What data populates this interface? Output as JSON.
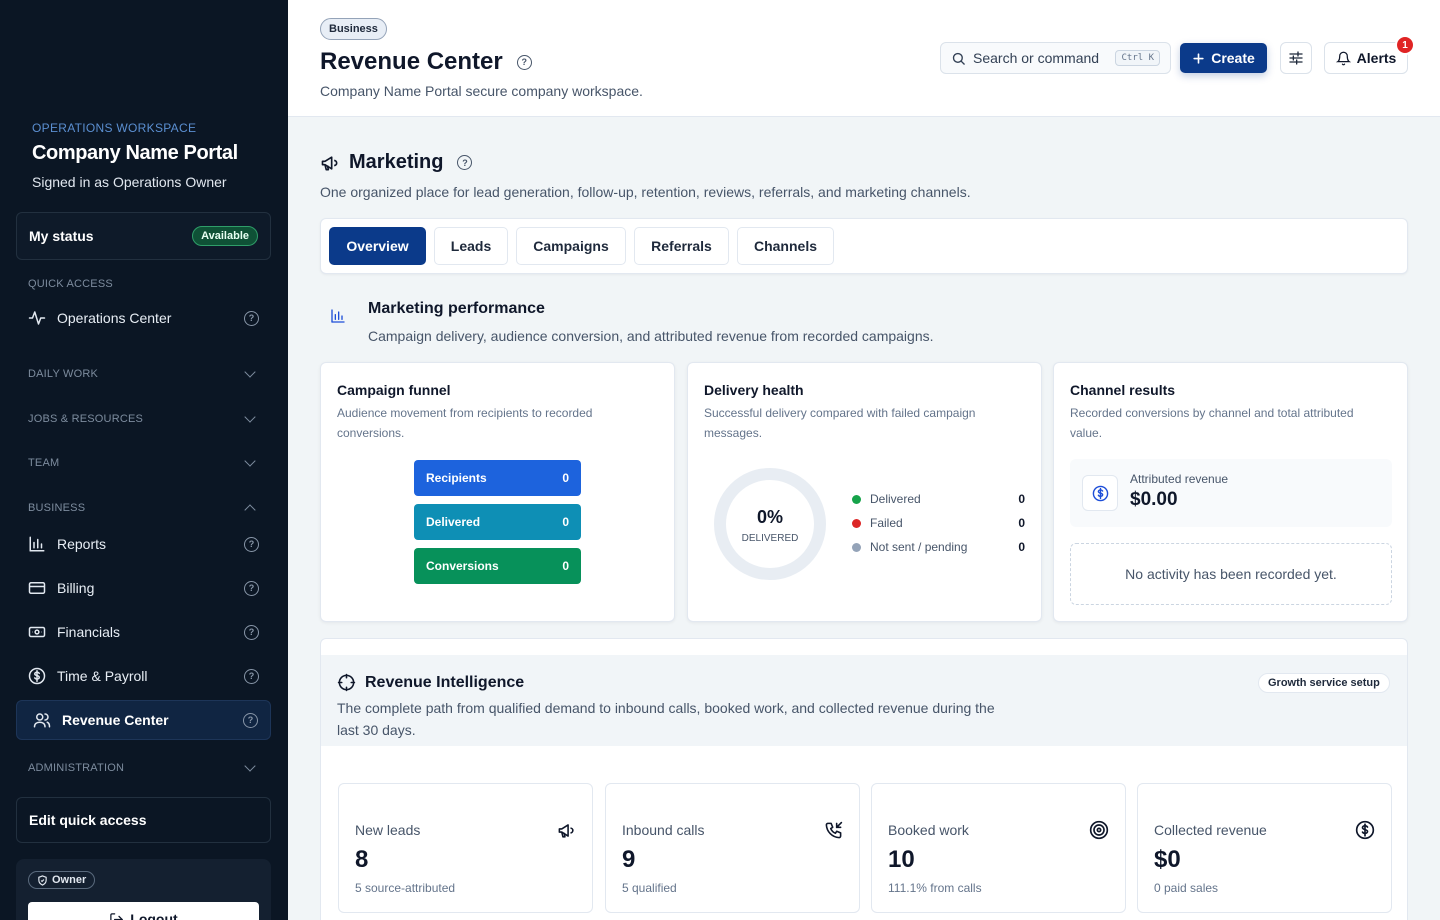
{
  "sidebar": {
    "workspace_label": "OPERATIONS WORKSPACE",
    "workspace_name": "Company Name Portal",
    "signed_in": "Signed in as Operations Owner",
    "my_status": {
      "label": "My status",
      "badge": "Available"
    },
    "quick_access_head": "QUICK ACCESS",
    "quick_access_item": "Operations Center",
    "daily_work": "DAILY WORK",
    "jobs_resources": "JOBS & RESOURCES",
    "team": "TEAM",
    "business": "BUSINESS",
    "business_items": [
      {
        "label": "Reports",
        "icon": "bar-chart-icon"
      },
      {
        "label": "Billing",
        "icon": "credit-card-icon"
      },
      {
        "label": "Financials",
        "icon": "cash-icon"
      },
      {
        "label": "Time & Payroll",
        "icon": "dollar-circle-icon"
      },
      {
        "label": "Revenue Center",
        "icon": "users-icon",
        "active": true
      }
    ],
    "administration": "ADMINISTRATION",
    "edit_quick_access": "Edit quick access",
    "owner_badge": "Owner",
    "logout": "Logout"
  },
  "header": {
    "badge": "Business",
    "title": "Revenue Center",
    "subtitle": "Company Name Portal secure company workspace.",
    "search_placeholder": "Search or command",
    "search_shortcut": "Ctrl K",
    "create_label": "Create",
    "alerts_label": "Alerts",
    "alerts_count": "1"
  },
  "marketing": {
    "title": "Marketing",
    "subtitle": "One organized place for lead generation, follow-up, retention, reviews, referrals, and marketing channels.",
    "tabs": [
      "Overview",
      "Leads",
      "Campaigns",
      "Referrals",
      "Channels"
    ],
    "active_tab": "Overview"
  },
  "performance": {
    "title": "Marketing performance",
    "subtitle": "Campaign delivery, audience conversion, and attributed revenue from recorded campaigns."
  },
  "funnel": {
    "title": "Campaign funnel",
    "subtitle": "Audience movement from recipients to recorded conversions.",
    "bars": [
      {
        "label": "Recipients",
        "value": "0",
        "color": "#1d63dd"
      },
      {
        "label": "Delivered",
        "value": "0",
        "color": "#0e8fb5"
      },
      {
        "label": "Conversions",
        "value": "0",
        "color": "#07915a"
      }
    ]
  },
  "delivery": {
    "title": "Delivery health",
    "subtitle": "Successful delivery compared with failed campaign messages.",
    "percent": "0%",
    "percent_label": "DELIVERED",
    "delivered_fraction": 0,
    "legend": [
      {
        "label": "Delivered",
        "value": "0",
        "color": "#16a34a"
      },
      {
        "label": "Failed",
        "value": "0",
        "color": "#dc2626"
      },
      {
        "label": "Not sent / pending",
        "value": "0",
        "color": "#94a3b8"
      }
    ]
  },
  "channels": {
    "title": "Channel results",
    "subtitle": "Recorded conversions by channel and total attributed value.",
    "attributed_label": "Attributed revenue",
    "attributed_value": "$0.00",
    "empty": "No activity has been recorded yet."
  },
  "revenue_intelligence": {
    "title": "Revenue Intelligence",
    "subtitle": "The complete path from qualified demand to inbound calls, booked work, and collected revenue during the last 30 days.",
    "badge": "Growth service setup",
    "kpis": [
      {
        "label": "New leads",
        "value": "8",
        "note": "5 source-attributed",
        "icon": "megaphone-icon"
      },
      {
        "label": "Inbound calls",
        "value": "9",
        "note": "5 qualified",
        "icon": "phone-incoming-icon"
      },
      {
        "label": "Booked work",
        "value": "10",
        "note": "111.1% from calls",
        "icon": "target-icon"
      },
      {
        "label": "Collected revenue",
        "value": "$0",
        "note": "0 paid sales",
        "icon": "dollar-circle-icon"
      }
    ]
  }
}
